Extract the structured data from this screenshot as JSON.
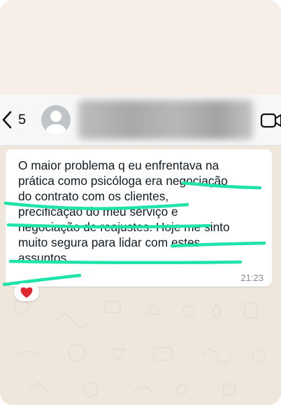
{
  "header": {
    "unread_count": "5",
    "back_icon": "chevron-left-icon",
    "avatar_icon": "default-person-avatar-icon",
    "video_icon": "video-camera-icon"
  },
  "message": {
    "text": "O maior problema q eu enfrentava na\nprática como psicóloga era negociação\ndo contrato com os clientes,\nprecificação do meu serviço e\nnegociação de reajustes. Hoje me sinto\nmuito segura para lidar com estes\nassuntos.",
    "time": "21:23",
    "reaction_icon": "red-heart-icon"
  },
  "colors": {
    "highlight": "#1fe3a8",
    "chat_background": "#efe6dc",
    "bubble": "#ffffff",
    "header": "#f7f7f7",
    "heart": "#e0262f"
  }
}
